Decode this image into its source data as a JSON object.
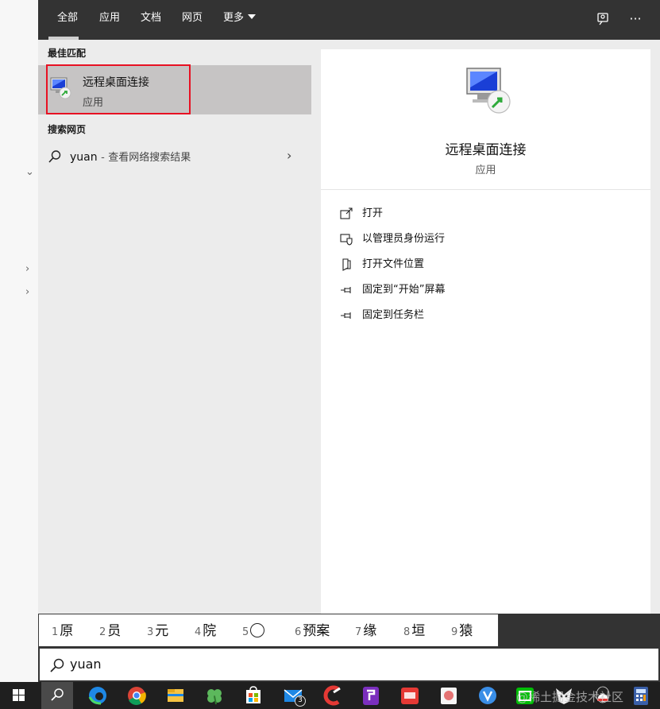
{
  "tabs": [
    {
      "label": "全部",
      "active": true
    },
    {
      "label": "应用"
    },
    {
      "label": "文档"
    },
    {
      "label": "网页"
    },
    {
      "label": "更多"
    }
  ],
  "top_icons": [
    "feedback-icon",
    "more-options-icon"
  ],
  "best_match": {
    "section_title": "最佳匹配",
    "name": "远程桌面连接",
    "type": "应用"
  },
  "web_search": {
    "section_title": "搜索网页",
    "query": "yuan",
    "separator": "-",
    "description": "查看网络搜索结果"
  },
  "preview": {
    "name": "远程桌面连接",
    "type": "应用"
  },
  "actions": [
    {
      "label": "打开",
      "icon": "open-icon"
    },
    {
      "label": "以管理员身份运行",
      "icon": "shield-icon"
    },
    {
      "label": "打开文件位置",
      "icon": "file-location-icon"
    },
    {
      "label": "固定到“开始”屏幕",
      "icon": "pin-icon"
    },
    {
      "label": "固定到任务栏",
      "icon": "pin-icon"
    }
  ],
  "ime_candidates": [
    {
      "num": "1",
      "text": "原"
    },
    {
      "num": "2",
      "text": "员"
    },
    {
      "num": "3",
      "text": "元"
    },
    {
      "num": "4",
      "text": "院"
    },
    {
      "num": "5",
      "text": ""
    },
    {
      "num": "6",
      "text": "预案"
    },
    {
      "num": "7",
      "text": "缘"
    },
    {
      "num": "8",
      "text": "垣"
    },
    {
      "num": "9",
      "text": "猿"
    }
  ],
  "search_box": {
    "value": "yuan"
  },
  "taskbar": {
    "mail_badge": "3",
    "watermark": "@稀土掘金技术社区"
  }
}
